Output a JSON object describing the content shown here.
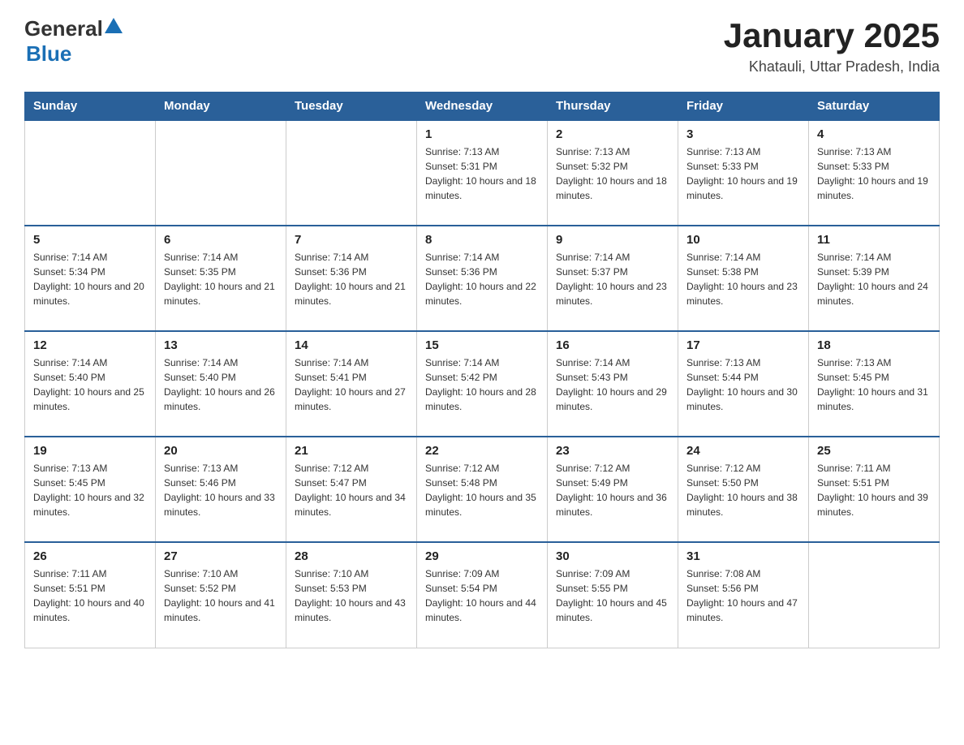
{
  "header": {
    "logo_text_general": "General",
    "logo_text_blue": "Blue",
    "title": "January 2025",
    "subtitle": "Khatauli, Uttar Pradesh, India"
  },
  "days_of_week": [
    "Sunday",
    "Monday",
    "Tuesday",
    "Wednesday",
    "Thursday",
    "Friday",
    "Saturday"
  ],
  "weeks": [
    [
      {
        "day": "",
        "info": ""
      },
      {
        "day": "",
        "info": ""
      },
      {
        "day": "",
        "info": ""
      },
      {
        "day": "1",
        "info": "Sunrise: 7:13 AM\nSunset: 5:31 PM\nDaylight: 10 hours and 18 minutes."
      },
      {
        "day": "2",
        "info": "Sunrise: 7:13 AM\nSunset: 5:32 PM\nDaylight: 10 hours and 18 minutes."
      },
      {
        "day": "3",
        "info": "Sunrise: 7:13 AM\nSunset: 5:33 PM\nDaylight: 10 hours and 19 minutes."
      },
      {
        "day": "4",
        "info": "Sunrise: 7:13 AM\nSunset: 5:33 PM\nDaylight: 10 hours and 19 minutes."
      }
    ],
    [
      {
        "day": "5",
        "info": "Sunrise: 7:14 AM\nSunset: 5:34 PM\nDaylight: 10 hours and 20 minutes."
      },
      {
        "day": "6",
        "info": "Sunrise: 7:14 AM\nSunset: 5:35 PM\nDaylight: 10 hours and 21 minutes."
      },
      {
        "day": "7",
        "info": "Sunrise: 7:14 AM\nSunset: 5:36 PM\nDaylight: 10 hours and 21 minutes."
      },
      {
        "day": "8",
        "info": "Sunrise: 7:14 AM\nSunset: 5:36 PM\nDaylight: 10 hours and 22 minutes."
      },
      {
        "day": "9",
        "info": "Sunrise: 7:14 AM\nSunset: 5:37 PM\nDaylight: 10 hours and 23 minutes."
      },
      {
        "day": "10",
        "info": "Sunrise: 7:14 AM\nSunset: 5:38 PM\nDaylight: 10 hours and 23 minutes."
      },
      {
        "day": "11",
        "info": "Sunrise: 7:14 AM\nSunset: 5:39 PM\nDaylight: 10 hours and 24 minutes."
      }
    ],
    [
      {
        "day": "12",
        "info": "Sunrise: 7:14 AM\nSunset: 5:40 PM\nDaylight: 10 hours and 25 minutes."
      },
      {
        "day": "13",
        "info": "Sunrise: 7:14 AM\nSunset: 5:40 PM\nDaylight: 10 hours and 26 minutes."
      },
      {
        "day": "14",
        "info": "Sunrise: 7:14 AM\nSunset: 5:41 PM\nDaylight: 10 hours and 27 minutes."
      },
      {
        "day": "15",
        "info": "Sunrise: 7:14 AM\nSunset: 5:42 PM\nDaylight: 10 hours and 28 minutes."
      },
      {
        "day": "16",
        "info": "Sunrise: 7:14 AM\nSunset: 5:43 PM\nDaylight: 10 hours and 29 minutes."
      },
      {
        "day": "17",
        "info": "Sunrise: 7:13 AM\nSunset: 5:44 PM\nDaylight: 10 hours and 30 minutes."
      },
      {
        "day": "18",
        "info": "Sunrise: 7:13 AM\nSunset: 5:45 PM\nDaylight: 10 hours and 31 minutes."
      }
    ],
    [
      {
        "day": "19",
        "info": "Sunrise: 7:13 AM\nSunset: 5:45 PM\nDaylight: 10 hours and 32 minutes."
      },
      {
        "day": "20",
        "info": "Sunrise: 7:13 AM\nSunset: 5:46 PM\nDaylight: 10 hours and 33 minutes."
      },
      {
        "day": "21",
        "info": "Sunrise: 7:12 AM\nSunset: 5:47 PM\nDaylight: 10 hours and 34 minutes."
      },
      {
        "day": "22",
        "info": "Sunrise: 7:12 AM\nSunset: 5:48 PM\nDaylight: 10 hours and 35 minutes."
      },
      {
        "day": "23",
        "info": "Sunrise: 7:12 AM\nSunset: 5:49 PM\nDaylight: 10 hours and 36 minutes."
      },
      {
        "day": "24",
        "info": "Sunrise: 7:12 AM\nSunset: 5:50 PM\nDaylight: 10 hours and 38 minutes."
      },
      {
        "day": "25",
        "info": "Sunrise: 7:11 AM\nSunset: 5:51 PM\nDaylight: 10 hours and 39 minutes."
      }
    ],
    [
      {
        "day": "26",
        "info": "Sunrise: 7:11 AM\nSunset: 5:51 PM\nDaylight: 10 hours and 40 minutes."
      },
      {
        "day": "27",
        "info": "Sunrise: 7:10 AM\nSunset: 5:52 PM\nDaylight: 10 hours and 41 minutes."
      },
      {
        "day": "28",
        "info": "Sunrise: 7:10 AM\nSunset: 5:53 PM\nDaylight: 10 hours and 43 minutes."
      },
      {
        "day": "29",
        "info": "Sunrise: 7:09 AM\nSunset: 5:54 PM\nDaylight: 10 hours and 44 minutes."
      },
      {
        "day": "30",
        "info": "Sunrise: 7:09 AM\nSunset: 5:55 PM\nDaylight: 10 hours and 45 minutes."
      },
      {
        "day": "31",
        "info": "Sunrise: 7:08 AM\nSunset: 5:56 PM\nDaylight: 10 hours and 47 minutes."
      },
      {
        "day": "",
        "info": ""
      }
    ]
  ]
}
